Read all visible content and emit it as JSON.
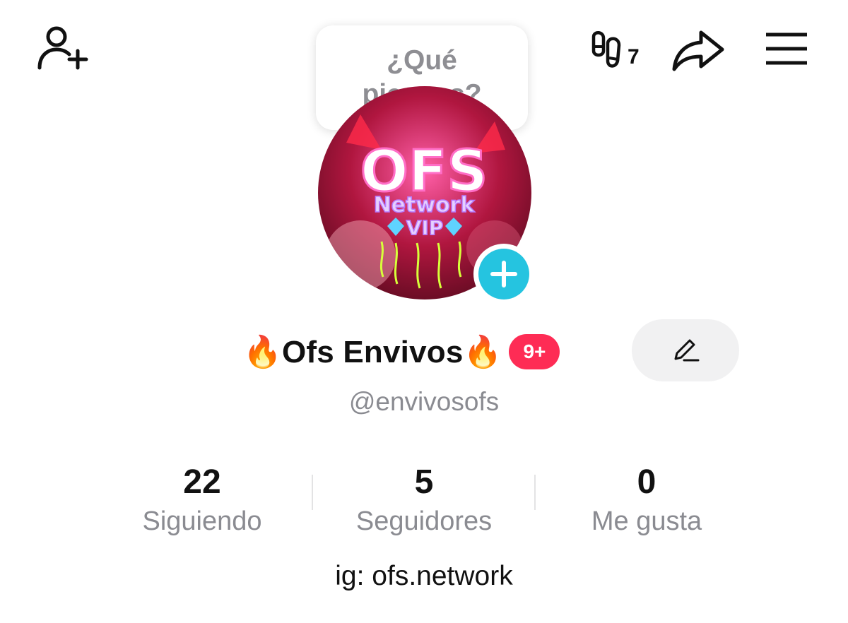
{
  "header": {
    "add_friend_icon": "add-user-icon",
    "footprints_icon": "footprints-icon",
    "footprints_count": "7",
    "share_icon": "share-arrow-icon",
    "menu_icon": "hamburger-menu-icon"
  },
  "status_bubble": {
    "text": "¿Qué piensas?"
  },
  "profile": {
    "display_name": "🔥Ofs Envivos🔥",
    "notification_badge": "9+",
    "username": "@envivosofs",
    "avatar_text": {
      "line1": "OFS",
      "line2": "Network",
      "line3": "VIP"
    },
    "edit_icon": "pencil-icon",
    "bio": "ig: ofs.network"
  },
  "stats": [
    {
      "value": "22",
      "label": "Siguiendo"
    },
    {
      "value": "5",
      "label": "Seguidores"
    },
    {
      "value": "0",
      "label": "Me gusta"
    }
  ],
  "colors": {
    "accent_red": "#fe2c55",
    "add_button_cyan": "#25c4e0",
    "secondary_text": "#8a8b91",
    "edit_button_bg": "#f1f1f2"
  }
}
